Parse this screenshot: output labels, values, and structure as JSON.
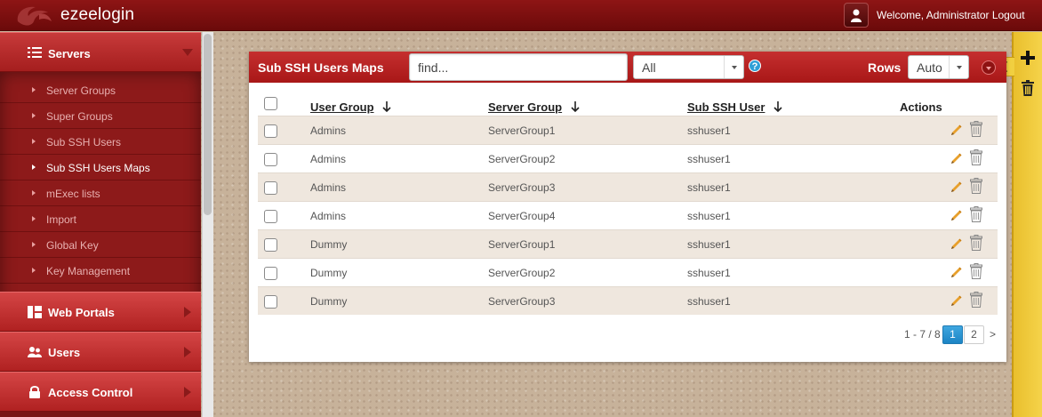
{
  "header": {
    "app_title": "ezeelogin",
    "welcome_text": "Welcome, Administrator Logout"
  },
  "sidebar": {
    "sections": [
      {
        "label": "Servers",
        "icon": "list-icon",
        "expanded": true
      },
      {
        "label": "Web Portals",
        "icon": "dashboard-icon",
        "expanded": false
      },
      {
        "label": "Users",
        "icon": "users-icon",
        "expanded": false
      },
      {
        "label": "Access Control",
        "icon": "lock-icon",
        "expanded": false
      }
    ],
    "items": [
      {
        "label": "Server Groups"
      },
      {
        "label": "Super Groups"
      },
      {
        "label": "Sub SSH Users"
      },
      {
        "label": "Sub SSH Users Maps",
        "current": true
      },
      {
        "label": "mExec lists"
      },
      {
        "label": "Import"
      },
      {
        "label": "Global Key"
      },
      {
        "label": "Key Management"
      }
    ]
  },
  "panel": {
    "title": "Sub SSH Users Maps",
    "search": {
      "placeholder": "find...",
      "value": ""
    },
    "filter_value": "All",
    "help_label": "?",
    "rows_label": "Rows",
    "rows_value": "Auto"
  },
  "table": {
    "columns": [
      "User Group",
      "Server Group",
      "Sub SSH User",
      "Actions"
    ],
    "rows": [
      [
        "Admins",
        "ServerGroup1",
        "sshuser1"
      ],
      [
        "Admins",
        "ServerGroup2",
        "sshuser1"
      ],
      [
        "Admins",
        "ServerGroup3",
        "sshuser1"
      ],
      [
        "Admins",
        "ServerGroup4",
        "sshuser1"
      ],
      [
        "Dummy",
        "ServerGroup1",
        "sshuser1"
      ],
      [
        "Dummy",
        "ServerGroup2",
        "sshuser1"
      ],
      [
        "Dummy",
        "ServerGroup3",
        "sshuser1"
      ]
    ]
  },
  "pagination": {
    "summary": "1 - 7 / 8",
    "pages": [
      "1",
      "2"
    ],
    "current_page": "1",
    "next": ">"
  },
  "colors": {
    "brand_red": "#a81717",
    "accent_yellow": "#f5d34a",
    "active_page": "#1c84c4"
  }
}
